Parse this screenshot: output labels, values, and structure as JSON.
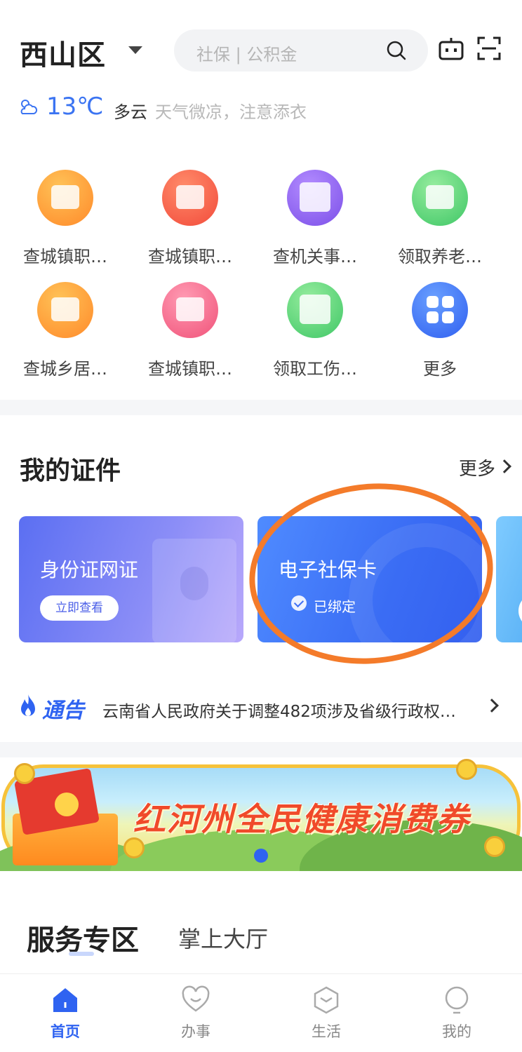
{
  "header": {
    "district": "西山区",
    "search_placeholder": "社保 | 公积金"
  },
  "weather": {
    "temperature": "13℃",
    "condition": "多云",
    "tip": "天气微凉，注意添衣"
  },
  "services": [
    {
      "label": "查城镇职…",
      "color": "#ff9a2e",
      "icon": "elderly-insurance-icon"
    },
    {
      "label": "查城镇职…",
      "color": "#f5563e",
      "icon": "unemployment-insurance-icon"
    },
    {
      "label": "查机关事…",
      "color": "#8b5ff0",
      "icon": "payment-query-icon"
    },
    {
      "label": "领取养老…",
      "color": "#4fcf6f",
      "icon": "pension-card-icon"
    },
    {
      "label": "查城乡居…",
      "color": "#ff9a2e",
      "icon": "residence-info-icon"
    },
    {
      "label": "查城镇职…",
      "color": "#f05a82",
      "icon": "elderly-more-icon"
    },
    {
      "label": "领取工伤…",
      "color": "#4fcf6f",
      "icon": "work-injury-icon"
    },
    {
      "label": "更多",
      "color": "#3b6cf4",
      "icon": "more-grid-icon"
    }
  ],
  "credentials": {
    "title": "我的证件",
    "more_label": "更多",
    "cards": [
      {
        "title": "身份证网证",
        "button": "立即查看"
      },
      {
        "title": "电子社保卡",
        "status": "已绑定"
      }
    ]
  },
  "notice": {
    "tag": "通告",
    "text": "云南省人民政府关于调整482项涉及省级行政权…"
  },
  "banner": {
    "text": "红河州全民健康消费券"
  },
  "tabs": {
    "active": "服务专区",
    "other": "掌上大厅"
  },
  "bottom_nav": [
    {
      "label": "首页",
      "icon": "home-icon",
      "active": true
    },
    {
      "label": "办事",
      "icon": "heart-icon",
      "active": false
    },
    {
      "label": "生活",
      "icon": "life-icon",
      "active": false
    },
    {
      "label": "我的",
      "icon": "profile-icon",
      "active": false
    }
  ],
  "colors": {
    "accent": "#2f63f1",
    "annotation": "#f47b2a"
  }
}
